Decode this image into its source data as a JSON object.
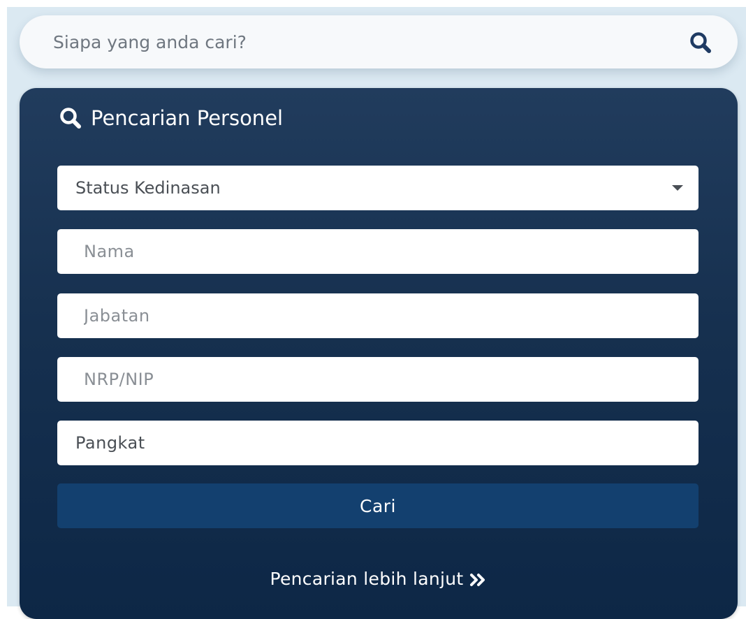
{
  "top_search": {
    "placeholder": "Siapa yang anda cari?",
    "icon": "search-icon"
  },
  "panel": {
    "title": "Pencarian Personel",
    "title_icon": "search-icon",
    "status_select": {
      "selected": "Status Kedinasan",
      "icon": "caret-down-icon"
    },
    "nama": {
      "placeholder": "Nama"
    },
    "jabatan": {
      "placeholder": "Jabatan"
    },
    "nrp_nip": {
      "placeholder": "NRP/NIP"
    },
    "pangkat": {
      "placeholder": "Pangkat"
    },
    "submit_label": "Cari",
    "more_link": {
      "label": "Pencarian lebih lanjut",
      "icon": "double-chevron-right-icon"
    }
  },
  "colors": {
    "page_background": "#dbe9f2",
    "panel_top": "#213c5d",
    "panel_bottom": "#0d2746",
    "button": "#13406f",
    "search_icon": "#1f3b63"
  }
}
